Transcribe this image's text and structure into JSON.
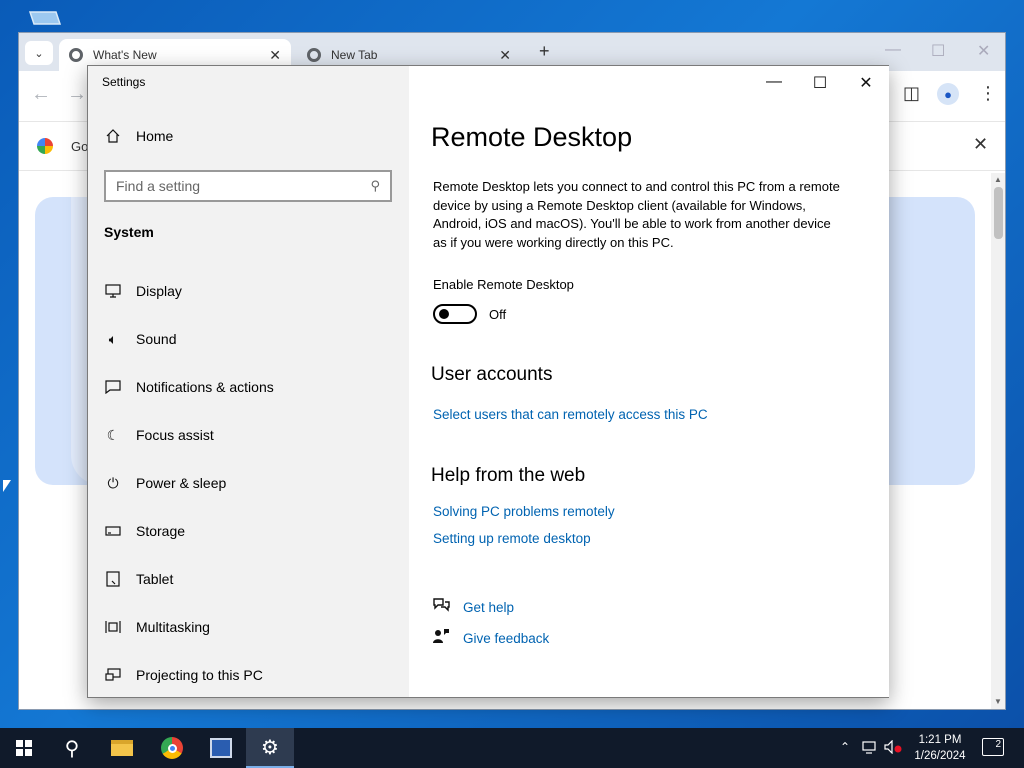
{
  "chrome": {
    "tabs": [
      {
        "title": "What's New",
        "active": true
      },
      {
        "title": "New Tab",
        "active": false
      }
    ],
    "new_tab_glyph": "+",
    "infobar_text": "Go"
  },
  "settings": {
    "window_title": "Settings",
    "sidebar": {
      "home_label": "Home",
      "search_placeholder": "Find a setting",
      "section_title": "System",
      "items": [
        {
          "label": "Display",
          "icon": "monitor-icon"
        },
        {
          "label": "Sound",
          "icon": "speaker-icon"
        },
        {
          "label": "Notifications & actions",
          "icon": "notification-icon"
        },
        {
          "label": "Focus assist",
          "icon": "moon-icon"
        },
        {
          "label": "Power & sleep",
          "icon": "power-icon"
        },
        {
          "label": "Storage",
          "icon": "storage-icon"
        },
        {
          "label": "Tablet",
          "icon": "tablet-icon"
        },
        {
          "label": "Multitasking",
          "icon": "multitasking-icon"
        },
        {
          "label": "Projecting to this PC",
          "icon": "projector-icon"
        }
      ]
    },
    "main": {
      "title": "Remote Desktop",
      "description": "Remote Desktop lets you connect to and control this PC from a remote device by using a Remote Desktop client (available for Windows, Android, iOS and macOS). You'll be able to work from another device as if you were working directly on this PC.",
      "enable_label": "Enable Remote Desktop",
      "toggle_state": "Off",
      "toggle_on": false,
      "user_accounts_heading": "User accounts",
      "user_accounts_link": "Select users that can remotely access this PC",
      "help_heading": "Help from the web",
      "help_links": [
        "Solving PC problems remotely",
        "Setting up remote desktop"
      ],
      "get_help": "Get help",
      "give_feedback": "Give feedback"
    }
  },
  "taskbar": {
    "time": "1:21 PM",
    "date": "1/26/2024",
    "notification_count": "2"
  },
  "colors": {
    "link": "#0063b1",
    "sidebar_bg": "#f2f2f2",
    "taskbar_bg": "#101a2a",
    "desktop_bg": "#0a5bb8"
  }
}
